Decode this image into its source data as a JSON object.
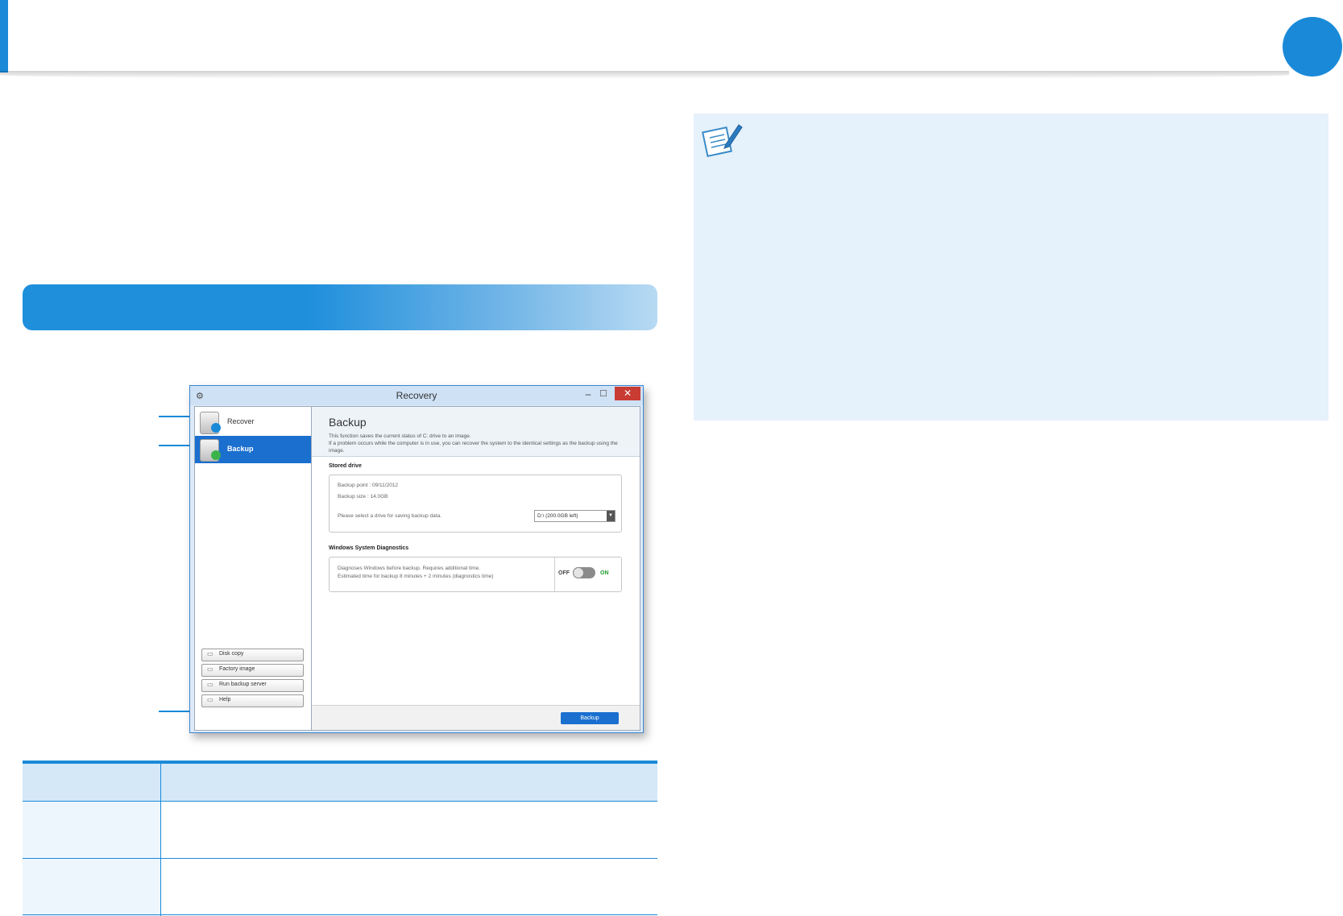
{
  "window": {
    "title": "Recovery",
    "icon": "app-icon",
    "minimize_glyph": "–",
    "maximize_glyph": "☐",
    "close_glyph": "✕"
  },
  "sidebar": {
    "items": [
      {
        "label": "Recover",
        "icon": "recover-drive-icon",
        "active": false
      },
      {
        "label": "Backup",
        "icon": "backup-drive-icon",
        "active": true
      }
    ],
    "buttons": [
      {
        "label": "Disk copy",
        "icon": "disk-copy-icon"
      },
      {
        "label": "Factory image",
        "icon": "factory-image-icon"
      },
      {
        "label": "Run backup server",
        "icon": "backup-server-icon"
      },
      {
        "label": "Help",
        "icon": "help-icon"
      }
    ]
  },
  "content": {
    "title": "Backup",
    "description_line1": "This function saves the current status of C: drive to an image.",
    "description_line2": "If a problem occurs while the computer is in use, you can recover the system to the identical settings as the backup using the image.",
    "stored_drive": {
      "heading": "Stored drive",
      "backup_point": "Backup point : 09/11/2012",
      "backup_size": "Backup size : 14.0GB",
      "select_prompt": "Please select a drive for saving backup data.",
      "drive_selected": "D:\\ (200.0GB left)"
    },
    "diagnostics": {
      "heading": "Windows System Diagnostics",
      "line1": "Diagnoses Windows before backup. Requires additional time.",
      "line2": "Estimated time for backup 8 minutes + 2 minutes (diagnostics time)",
      "off_label": "OFF",
      "on_label": "ON",
      "state": "off"
    },
    "backup_button": "Backup"
  },
  "colors": {
    "accent": "#1a8ad8",
    "active_item": "#1a6fcf",
    "close_button": "#c83c33",
    "note_background": "#e5f1fb",
    "table_header": "#d4e8f8",
    "toggle_on_text": "#1f9b2e"
  },
  "note_panel": {
    "icon": "note-pencil-icon"
  }
}
